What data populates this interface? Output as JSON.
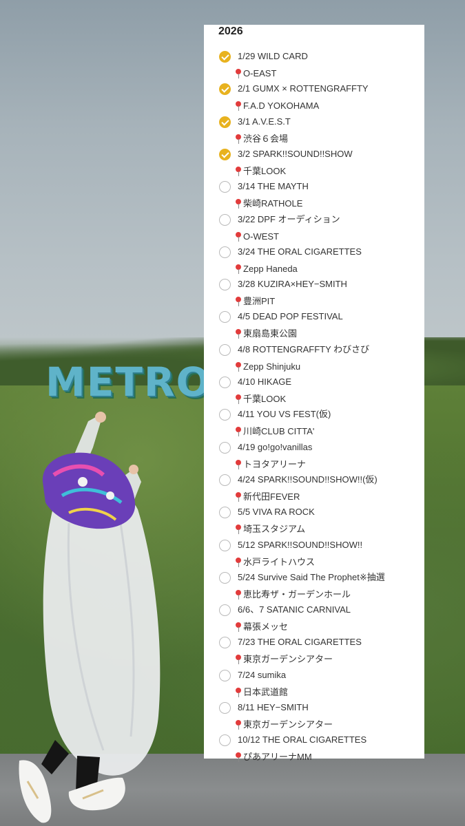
{
  "note": {
    "year": "2026",
    "entries": [
      {
        "event": "1/29 WILD CARD",
        "venue": "O-EAST",
        "done": true
      },
      {
        "event": "2/1 GUMX × ROTTENGRAFFTY",
        "venue": "F.A.D YOKOHAMA",
        "done": true
      },
      {
        "event": "3/1 A.V.E.S.T",
        "venue": "渋谷６会場",
        "done": true
      },
      {
        "event": "3/2 SPARK!!SOUND!!SHOW",
        "venue": "千葉LOOK",
        "done": true
      },
      {
        "event": "3/14  THE MAYTH",
        "venue": "柴崎RATHOLE",
        "done": false
      },
      {
        "event": "3/22   DPF オーディション",
        "venue": "O-WEST",
        "done": false
      },
      {
        "event": "3/24  THE ORAL CIGARETTES",
        "venue": "Zepp Haneda",
        "done": false
      },
      {
        "event": "3/28  KUZIRA×HEY−SMITH",
        "venue": "豊洲PIT",
        "done": false
      },
      {
        "event": "4/5 DEAD POP FESTIVAL",
        "venue": "東扇島東公園",
        "done": false
      },
      {
        "event": "4/8 ROTTENGRAFFTY わびさび",
        "venue": "Zepp Shinjuku",
        "done": false
      },
      {
        "event": "4/10 HIKAGE",
        "venue": "千葉LOOK",
        "done": false
      },
      {
        "event": "4/11 YOU VS FEST(仮)",
        "venue": "川崎CLUB CITTA'",
        "done": false
      },
      {
        "event": "4/19  go!go!vanillas",
        "venue": "トヨタアリーナ",
        "done": false
      },
      {
        "event": "4/24 SPARK!!SOUND!!SHOW!!(仮)",
        "venue": "新代田FEVER",
        "done": false
      },
      {
        "event": "5/5 VIVA RA ROCK",
        "venue": "埼玉スタジアム",
        "done": false
      },
      {
        "event": "5/12  SPARK!!SOUND!!SHOW!!",
        "venue": "水戸ライトハウス",
        "done": false
      },
      {
        "event": "5/24 Survive Said The Prophet※抽選",
        "venue": "恵比寿ザ・ガーデンホール",
        "done": false
      },
      {
        "event": "6/6、7 SATANIC CARNIVAL",
        "venue": "幕張メッセ",
        "done": false
      },
      {
        "event": "7/23  THE ORAL CIGARETTES",
        "venue": "東京ガーデンシアター",
        "done": false
      },
      {
        "event": "7/24  sumika",
        "venue": "日本武道館",
        "done": false
      },
      {
        "event": "8/11  HEY−SMITH",
        "venue": "東京ガーデンシアター",
        "done": false
      },
      {
        "event": "10/12   THE ORAL CIGARETTES",
        "venue": "ぴあアリーナMM",
        "done": false
      }
    ]
  },
  "background": {
    "sign_text": "METRO"
  },
  "colors": {
    "check_done": "#e8b21f",
    "check_todo_border": "#b9b9b9",
    "pin": "#e23b3b",
    "text": "#333333"
  }
}
